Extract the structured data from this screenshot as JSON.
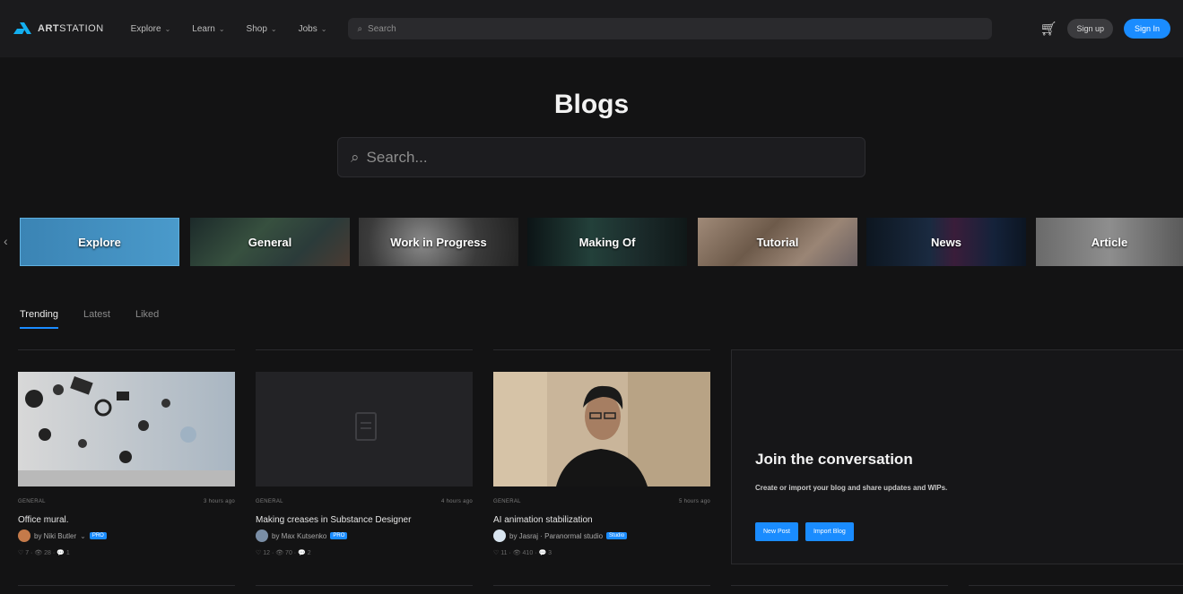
{
  "topbar": {
    "brand_prefix": "ART",
    "brand_suffix": "STATION",
    "nav": [
      {
        "label": "Explore"
      },
      {
        "label": "Learn"
      },
      {
        "label": "Shop"
      },
      {
        "label": "Jobs"
      }
    ],
    "search_placeholder": "Search",
    "signup_label": "Sign up",
    "signin_label": "Sign In"
  },
  "hero": {
    "title": "Blogs",
    "search_placeholder": "Search..."
  },
  "categories": [
    {
      "label": "Explore",
      "selected": true
    },
    {
      "label": "General"
    },
    {
      "label": "Work in Progress"
    },
    {
      "label": "Making Of"
    },
    {
      "label": "Tutorial"
    },
    {
      "label": "News"
    },
    {
      "label": "Article"
    }
  ],
  "tabs": [
    {
      "label": "Trending",
      "active": true
    },
    {
      "label": "Latest"
    },
    {
      "label": "Liked"
    }
  ],
  "cards": [
    {
      "category": "GENERAL",
      "time": "3 hours ago",
      "title": "Office mural.",
      "author": "by Niki Butler",
      "badge": "PRO",
      "stats": "♡ 7 · 👁 28 · 💬 1"
    },
    {
      "category": "GENERAL",
      "time": "4 hours ago",
      "title": "Making creases in Substance Designer",
      "author": "by Max Kutsenko",
      "badge": "PRO",
      "stats": "♡ 12 · 👁 70 · 💬 2"
    },
    {
      "category": "GENERAL",
      "time": "5 hours ago",
      "title": "AI animation stabilization",
      "author": "by Jasraj · Paranormal studio",
      "badge": "Studio",
      "stats": "♡ 11 · 👁 410 · 💬 3"
    }
  ],
  "join": {
    "title": "Join the conversation",
    "description": "Create or import your blog and share updates and WIPs.",
    "new_post_label": "New Post",
    "import_label": "Import Blog"
  },
  "colors": {
    "accent": "#1a8cff",
    "background": "#131314"
  }
}
